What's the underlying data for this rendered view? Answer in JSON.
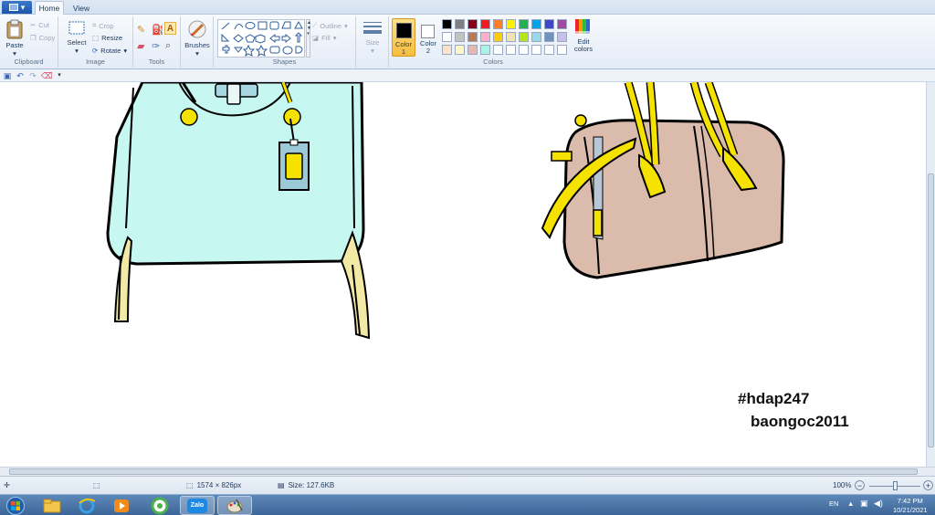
{
  "tabs": {
    "file_label": "",
    "home": "Home",
    "view": "View"
  },
  "clipboard": {
    "paste": "Paste",
    "cut": "Cut",
    "copy": "Copy",
    "group": "Clipboard"
  },
  "image": {
    "select": "Select",
    "crop": "Crop",
    "resize": "Resize",
    "rotate": "Rotate",
    "group": "Image"
  },
  "tools": {
    "group": "Tools",
    "brushes": "Brushes"
  },
  "shapes": {
    "outline": "Outline",
    "fill": "Fill",
    "group": "Shapes"
  },
  "size": {
    "label": "Size"
  },
  "colors": {
    "color1": "Color\n1",
    "color1_a": "Color",
    "color1_b": "1",
    "color2_a": "Color",
    "color2_b": "2",
    "edit_a": "Edit",
    "edit_b": "colors",
    "group": "Colors",
    "palette_row1": [
      "#000000",
      "#7f7f7f",
      "#880015",
      "#ed1c24",
      "#ff7f27",
      "#fff200",
      "#22b14c",
      "#00a2e8",
      "#3f48cc",
      "#a349a4"
    ],
    "palette_row2": [
      "#ffffff",
      "#c3c3c3",
      "#b97a57",
      "#ffaec9",
      "#ffc90e",
      "#efe4b0",
      "#b5e61d",
      "#99d9ea",
      "#7092be",
      "#c8bfe7"
    ],
    "palette_row3": [
      "#fde2c9",
      "#fff6c7",
      "#e6b8b0",
      "#a8f5e8",
      "#ffffff",
      "#ffffff",
      "#ffffff",
      "#ffffff",
      "#ffffff",
      "#ffffff"
    ]
  },
  "canvas": {
    "hashtag": "#hdap247",
    "username": "baongoc2011"
  },
  "status": {
    "dimensions": "1574 × 826px",
    "size": "Size: 127.6KB",
    "zoom": "100%"
  },
  "taskbar": {
    "lang": "EN",
    "time": "7:42 PM",
    "date": "10/21/2021",
    "zalo": "Zalo"
  }
}
